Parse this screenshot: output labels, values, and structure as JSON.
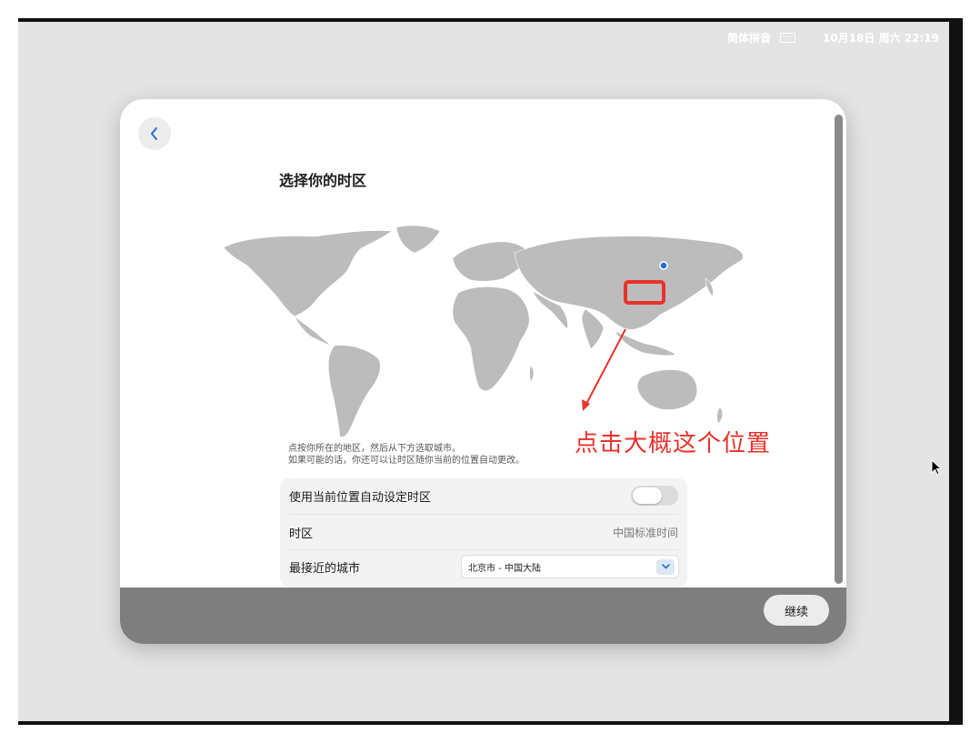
{
  "menubar": {
    "input_method": "简体拼音",
    "keyboard_icon": "keyboard-icon",
    "datetime": "10月18日 周六  22:19"
  },
  "setup": {
    "back_icon": "chevron-left-icon",
    "title": "选择你的时区",
    "hint_line_1": "点按你所在的地区，然后从下方选取城市。",
    "hint_line_2": "如果可能的话，你还可以让时区随你当前的位置自动更改。",
    "auto_timezone_label": "使用当前位置自动设定时区",
    "auto_timezone_enabled": false,
    "timezone_label": "时区",
    "timezone_value": "中国标准时间",
    "closest_city_label": "最接近的城市",
    "closest_city_value": "北京市 - 中国大陆",
    "continue_label": "继续"
  },
  "annotation": {
    "text": "点击大概这个位置",
    "color": "#e8322a"
  },
  "colors": {
    "accent": "#1e6fd0",
    "map_land": "#bcbcbc",
    "footer": "#7e7e7e"
  }
}
